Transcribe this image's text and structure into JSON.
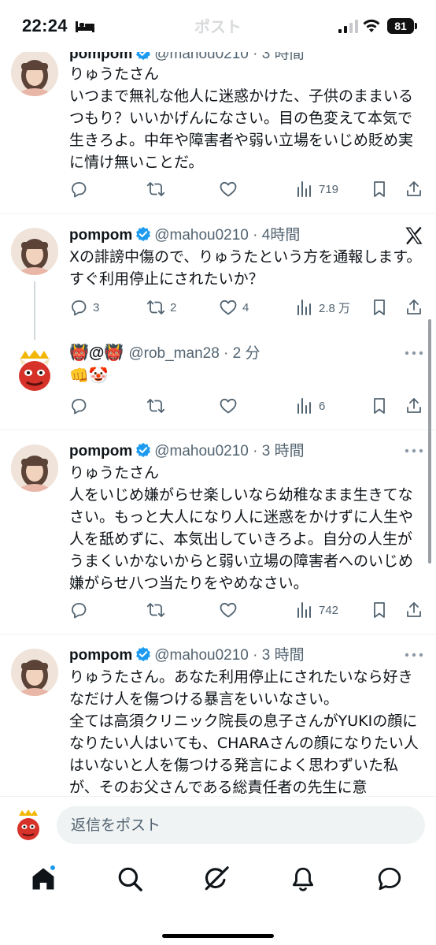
{
  "status_bar": {
    "time": "22:24",
    "title": "ポスト",
    "battery": "81"
  },
  "posts": [
    {
      "name": "pompom",
      "handle": "@mahou0210 · 3 時間",
      "text": "りゅうたさん\nいつまで無礼な他人に迷惑かけた、子供のままいるつもり？いいかげんになさい。目の色変えて本気で生きろよ。中年や障害者や弱い立場をいじめ貶め実に情け無いことだ。",
      "views": "719"
    },
    {
      "name": "pompom",
      "handle": "@mahou0210 · 4時間",
      "text": "Xの誹謗中傷ので、りゅうたという方を通報します。すぐ利用停止にされたいか？",
      "replies": "3",
      "reposts": "2",
      "likes": "4",
      "views": "2.8 万"
    },
    {
      "name_emoji": "👹@👹",
      "handle": "@rob_man28 · 2 分",
      "text": "👊🤡",
      "views": "6"
    },
    {
      "name": "pompom",
      "handle": "@mahou0210 · 3 時間",
      "text": "りゅうたさん\n人をいじめ嫌がらせ楽しいなら幼稚なまま生きてなさい。もっと大人になり人に迷惑をかけずに人生や人を舐めずに、本気出していきろよ。自分の人生がうまくいかないからと弱い立場の障害者へのいじめ嫌がらせ八つ当たりをやめなさい。",
      "views": "742"
    },
    {
      "name": "pompom",
      "handle": "@mahou0210 · 3 時間",
      "text": "りゅうたさん。あなた利用停止にされたいなら好きなだけ人を傷つける暴言をいいなさい。\n全ては高須クリニック院長の息子さんがYUKIの顔になりたい人はいても、CHARAさんの顔になりたい人はいないと人を傷つける発言によく思わずいた私が、そのお父さんである総責任者の先生に意"
    }
  ],
  "reply_bar": {
    "placeholder": "返信をポスト"
  },
  "icons": {
    "verified": "verified-badge-icon",
    "tabs": [
      "home-icon",
      "search-icon",
      "grok-icon",
      "notifications-icon",
      "messages-icon"
    ]
  },
  "colors": {
    "accent": "#1d9bf0",
    "muted": "#536471",
    "text": "#0f1419"
  }
}
